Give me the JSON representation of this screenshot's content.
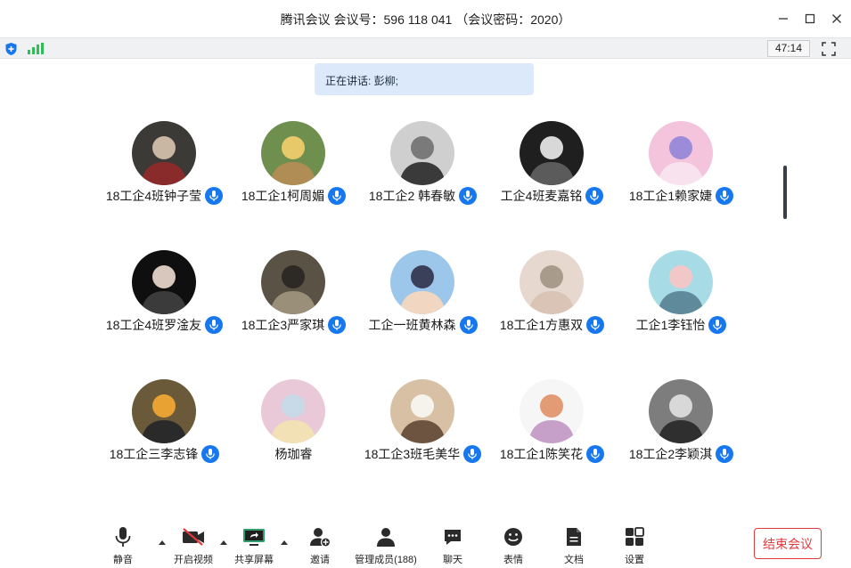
{
  "window": {
    "title": "腾讯会议 会议号：596 118 041 （会议密码：2020）"
  },
  "status": {
    "timer": "47:14",
    "shield_icon": "shield-icon",
    "signal_icon": "signal-strength-icon"
  },
  "speaking": {
    "label": "正在讲话: 彭柳;"
  },
  "participants": [
    {
      "name": "18工企4班钟子莹",
      "mic": true
    },
    {
      "name": "18工企1柯周媚",
      "mic": true
    },
    {
      "name": "18工企2 韩春敏",
      "mic": true
    },
    {
      "name": "工企4班麦嘉铭",
      "mic": true
    },
    {
      "name": "18工企1赖家婕",
      "mic": true
    },
    {
      "name": "18工企4班罗淦友",
      "mic": true
    },
    {
      "name": "18工企3严家琪",
      "mic": true
    },
    {
      "name": "工企一班黄林森",
      "mic": true
    },
    {
      "name": "18工企1方惠双",
      "mic": true
    },
    {
      "name": "工企1李钰怡",
      "mic": true
    },
    {
      "name": "18工企三李志锋",
      "mic": true
    },
    {
      "name": "杨珈睿",
      "mic": false
    },
    {
      "name": "18工企3班毛美华",
      "mic": true
    },
    {
      "name": "18工企1陈笑花",
      "mic": true
    },
    {
      "name": "18工企2李颖淇",
      "mic": true
    }
  ],
  "toolbar": {
    "mute": "静音",
    "video": "开启视频",
    "share": "共享屏幕",
    "invite": "邀请",
    "members": "管理成员(188)",
    "chat": "聊天",
    "emoji": "表情",
    "docs": "文档",
    "settings": "设置",
    "end": "结束会议"
  },
  "colors": {
    "accent": "#1677ee",
    "danger": "#e0393e",
    "speaking_bg": "#dbe9fb",
    "signal": "#2ebd59"
  }
}
